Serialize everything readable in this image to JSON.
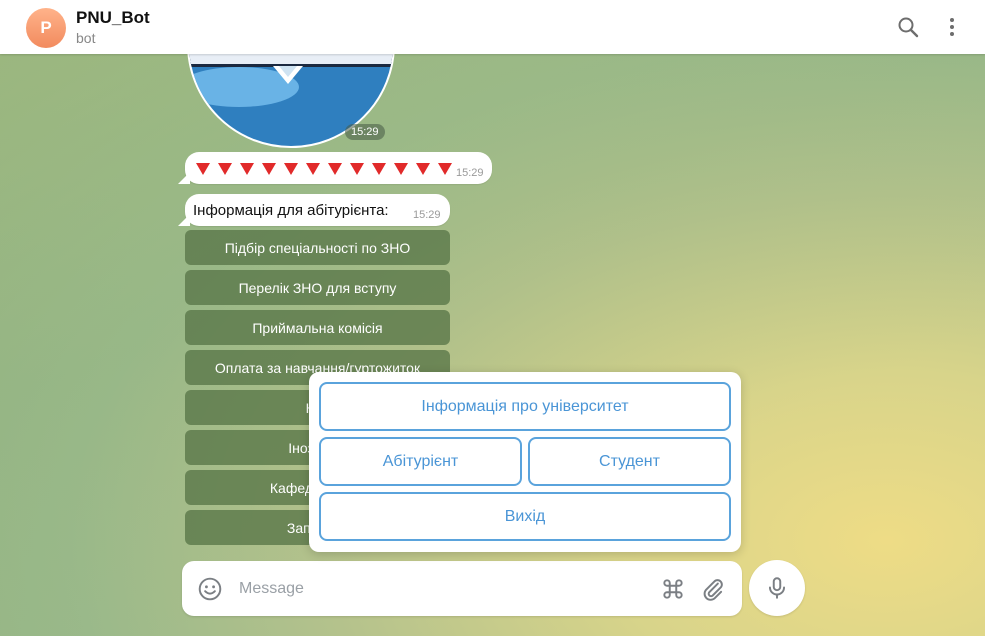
{
  "header": {
    "avatar_letter": "P",
    "title": "PNU_Bot",
    "subtitle": "bot"
  },
  "messages": {
    "sticker_time": "15:29",
    "arrows_time": "15:29",
    "arrows_count": 12,
    "info_text": "Інформація для абітурієнта:",
    "info_time": "15:29"
  },
  "inline_keyboard": [
    "Підбір спеціальності по ЗНО",
    "Перелік ЗНО для вступу",
    "Приймальна комісія",
    "Оплата за навчання/гуртожиток",
    "Кон",
    "Іноземно",
    "Кафедра війсь",
    "Запитанн"
  ],
  "reply_keyboard": {
    "row1": "Інформація про університет",
    "row2_left": "Абітурієнт",
    "row2_right": "Студент",
    "row3": "Вихід"
  },
  "composer": {
    "placeholder": "Message"
  },
  "colors": {
    "accent": "#4a95d6",
    "inline_button": "#587648",
    "arrow_red": "#e12a2a"
  },
  "icons": [
    "search-icon",
    "more-vertical-icon",
    "emoji-icon",
    "command-icon",
    "attach-icon",
    "mic-icon"
  ]
}
